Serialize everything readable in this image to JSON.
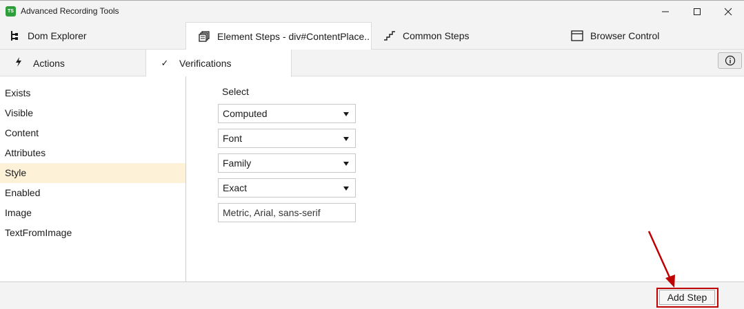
{
  "window": {
    "title": "Advanced Recording Tools",
    "app_icon_text": "TS",
    "controls": [
      "minimize-icon",
      "maximize-icon",
      "close-icon"
    ]
  },
  "tabs": [
    {
      "label": "Dom Explorer",
      "icon": "tree-icon"
    },
    {
      "label": "Element Steps - div#ContentPlace..",
      "icon": "stack-icon",
      "active": true
    },
    {
      "label": "Common Steps",
      "icon": "stairs-icon"
    },
    {
      "label": "Browser Control",
      "icon": "browser-icon"
    }
  ],
  "subtabs": [
    {
      "label": "Actions",
      "icon": "lightning-icon"
    },
    {
      "label": "Verifications",
      "icon": "check-icon",
      "active": true
    }
  ],
  "verifications": [
    {
      "label": "Exists"
    },
    {
      "label": "Visible"
    },
    {
      "label": "Content"
    },
    {
      "label": "Attributes"
    },
    {
      "label": "Style",
      "selected": true
    },
    {
      "label": "Enabled"
    },
    {
      "label": "Image"
    },
    {
      "label": "TextFromImage"
    }
  ],
  "form": {
    "select_label": "Select",
    "dropdowns": [
      "Computed",
      "Font",
      "Family",
      "Exact"
    ],
    "value": "Metric, Arial, sans-serif"
  },
  "footer": {
    "add_step_label": "Add Step"
  },
  "colors": {
    "selected_row": "#fdf1d8",
    "highlight": "#c00000",
    "app_icon": "#2e9e3a"
  }
}
